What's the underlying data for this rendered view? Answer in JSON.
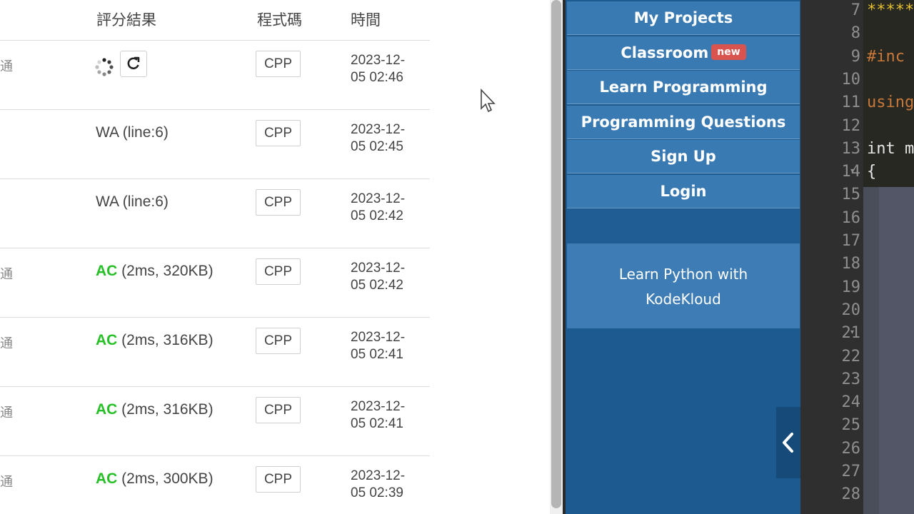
{
  "submissions": {
    "headers": {
      "result": "評分結果",
      "code": "程式碼",
      "time": "時間"
    },
    "rows": [
      {
        "cut_text": "通",
        "result_type": "pending",
        "status": "",
        "detail": "",
        "lang": "CPP",
        "time_line1": "2023-12-",
        "time_line2": "05 02:46"
      },
      {
        "cut_text": "",
        "result_type": "wa",
        "status": "",
        "detail": "WA (line:6)",
        "lang": "CPP",
        "time_line1": "2023-12-",
        "time_line2": "05 02:45"
      },
      {
        "cut_text": "",
        "result_type": "wa",
        "status": "",
        "detail": "WA (line:6)",
        "lang": "CPP",
        "time_line1": "2023-12-",
        "time_line2": "05 02:42"
      },
      {
        "cut_text": "通",
        "result_type": "ac",
        "status": "AC",
        "detail": " (2ms, 320KB)",
        "lang": "CPP",
        "time_line1": "2023-12-",
        "time_line2": "05 02:42"
      },
      {
        "cut_text": "通",
        "result_type": "ac",
        "status": "AC",
        "detail": " (2ms, 316KB)",
        "lang": "CPP",
        "time_line1": "2023-12-",
        "time_line2": "05 02:41"
      },
      {
        "cut_text": "通",
        "result_type": "ac",
        "status": "AC",
        "detail": " (2ms, 316KB)",
        "lang": "CPP",
        "time_line1": "2023-12-",
        "time_line2": "05 02:41"
      },
      {
        "cut_text": "通",
        "result_type": "ac",
        "status": "AC",
        "detail": " (2ms, 300KB)",
        "lang": "CPP",
        "time_line1": "2023-12-",
        "time_line2": "05 02:39"
      }
    ]
  },
  "nav": {
    "items": [
      {
        "label": "My Projects",
        "badge": ""
      },
      {
        "label": "Classroom",
        "badge": "new"
      },
      {
        "label": "Learn Programming",
        "badge": ""
      },
      {
        "label": "Programming Questions",
        "badge": ""
      },
      {
        "label": "Sign Up",
        "badge": ""
      },
      {
        "label": "Login",
        "badge": ""
      }
    ],
    "promo_line1": "Learn Python with",
    "promo_line2": "KodeKloud",
    "collapse_icon": "chevron-left-icon"
  },
  "editor": {
    "line_numbers": [
      "7",
      "8",
      "9",
      "10",
      "11",
      "12",
      "13",
      "14",
      "15",
      "16",
      "17",
      "18",
      "19",
      "20",
      "21",
      "22",
      "23",
      "24",
      "25",
      "26",
      "27",
      "28"
    ],
    "code_lines": [
      {
        "line": "7",
        "text": "*****",
        "kind": "comment"
      },
      {
        "line": "9",
        "text": "#inc",
        "kind": "preproc"
      },
      {
        "line": "11",
        "text": "using",
        "kind": "using"
      },
      {
        "line": "13",
        "text": "int m",
        "kind": "kw"
      },
      {
        "line": "14",
        "text": "{",
        "kind": "kw"
      }
    ]
  },
  "colors": {
    "ac_green": "#26c026",
    "nav_blue": "#3a7ab3",
    "badge_red": "#d9534f",
    "editor_bg": "#272822"
  }
}
